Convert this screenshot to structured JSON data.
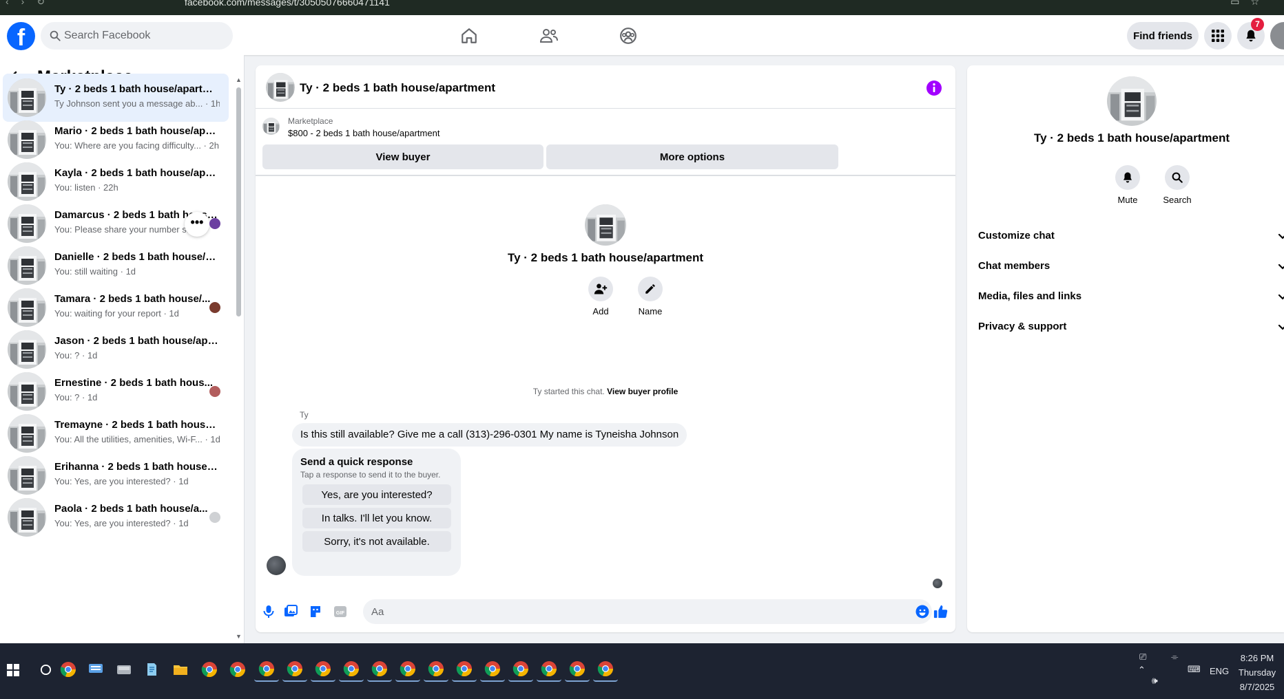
{
  "browser": {
    "url": "facebook.com/messages/t/30505076660471141"
  },
  "topnav": {
    "logo": "f",
    "search_placeholder": "Search Facebook",
    "find_friends": "Find friends",
    "notification_count": "7",
    "icons": [
      "home-icon",
      "friends-icon",
      "groups-icon",
      "menu-grid-icon",
      "bell-icon"
    ]
  },
  "sidebar": {
    "title": "Marketplace",
    "conversations": [
      {
        "title": "Ty · 2 beds 1 bath house/apartm...",
        "sub": "Ty Johnson sent you a message ab... · 1h",
        "active": true
      },
      {
        "title": "Mario · 2 beds 1 bath house/apa...",
        "sub": "You: Where are you facing difficulty... · 2h"
      },
      {
        "title": "Kayla · 2 beds 1 bath house/apar...",
        "sub": "You: listen · 22h"
      },
      {
        "title": "Damarcus · 2 beds 1 bath house/...",
        "sub": "You: Please share your number s...",
        "more": "•••"
      },
      {
        "title": "Danielle · 2 beds 1 bath house/a...",
        "sub": "You: still waiting · 1d"
      },
      {
        "title": "Tamara · 2 beds 1 bath house/...",
        "sub": "You: waiting for your report · 1d"
      },
      {
        "title": "Jason · 2 beds 1 bath house/apa...",
        "sub": "You: ? · 1d"
      },
      {
        "title": "Ernestine · 2 beds 1 bath hous...",
        "sub": "You: ? · 1d"
      },
      {
        "title": "Tremayne · 2 beds 1 bath house/...",
        "sub": "You: All the utilities, amenities, Wi-F... · 1d"
      },
      {
        "title": "Erihanna · 2 beds 1 bath house/a...",
        "sub": "You: Yes, are you interested? · 1d"
      },
      {
        "title": "Paola · 2 beds 1 bath house/a...",
        "sub": "You: Yes, are you interested? · 1d"
      }
    ]
  },
  "chat": {
    "title": "Ty · 2 beds 1 bath house/apartment",
    "listing_category": "Marketplace",
    "listing_price": "$800 - 2 beds 1 bath house/apartment",
    "view_buyer": "View buyer",
    "more_options": "More options",
    "intro_title": "Ty · 2 beds 1 bath house/apartment",
    "add_label": "Add",
    "name_label": "Name",
    "started_text": "Ty started this chat.",
    "view_profile": "View buyer profile",
    "sender": "Ty",
    "message": "Is this still available? Give me a call (313)-296-0301 My name is Tyneisha Johnson",
    "quick_title": "Send a quick response",
    "quick_sub": "Tap a response to send it to the buyer.",
    "quick_options": [
      "Yes, are you interested?",
      "In talks. I'll let you know.",
      "Sorry, it's not available."
    ],
    "composer_placeholder": "Aa"
  },
  "details": {
    "title": "Ty · 2 beds 1 bath house/apartment",
    "mute": "Mute",
    "search": "Search",
    "sections": [
      "Customize chat",
      "Chat members",
      "Media, files and links",
      "Privacy & support"
    ]
  },
  "taskbar": {
    "lang": "ENG",
    "time": "8:26 PM",
    "day": "Thursday",
    "date": "8/7/2025"
  },
  "colors": {
    "brand": "#0866ff",
    "accent_purple": "#a200ff",
    "badge": "#e41e3f",
    "taskbar": "#1d2331"
  }
}
